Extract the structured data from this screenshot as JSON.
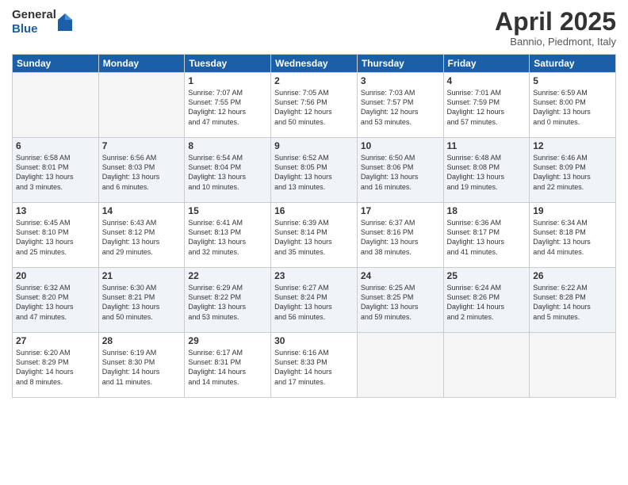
{
  "logo": {
    "general": "General",
    "blue": "Blue"
  },
  "header": {
    "month": "April 2025",
    "location": "Bannio, Piedmont, Italy"
  },
  "weekdays": [
    "Sunday",
    "Monday",
    "Tuesday",
    "Wednesday",
    "Thursday",
    "Friday",
    "Saturday"
  ],
  "weeks": [
    [
      {
        "day": "",
        "info": ""
      },
      {
        "day": "",
        "info": ""
      },
      {
        "day": "1",
        "info": "Sunrise: 7:07 AM\nSunset: 7:55 PM\nDaylight: 12 hours\nand 47 minutes."
      },
      {
        "day": "2",
        "info": "Sunrise: 7:05 AM\nSunset: 7:56 PM\nDaylight: 12 hours\nand 50 minutes."
      },
      {
        "day": "3",
        "info": "Sunrise: 7:03 AM\nSunset: 7:57 PM\nDaylight: 12 hours\nand 53 minutes."
      },
      {
        "day": "4",
        "info": "Sunrise: 7:01 AM\nSunset: 7:59 PM\nDaylight: 12 hours\nand 57 minutes."
      },
      {
        "day": "5",
        "info": "Sunrise: 6:59 AM\nSunset: 8:00 PM\nDaylight: 13 hours\nand 0 minutes."
      }
    ],
    [
      {
        "day": "6",
        "info": "Sunrise: 6:58 AM\nSunset: 8:01 PM\nDaylight: 13 hours\nand 3 minutes."
      },
      {
        "day": "7",
        "info": "Sunrise: 6:56 AM\nSunset: 8:03 PM\nDaylight: 13 hours\nand 6 minutes."
      },
      {
        "day": "8",
        "info": "Sunrise: 6:54 AM\nSunset: 8:04 PM\nDaylight: 13 hours\nand 10 minutes."
      },
      {
        "day": "9",
        "info": "Sunrise: 6:52 AM\nSunset: 8:05 PM\nDaylight: 13 hours\nand 13 minutes."
      },
      {
        "day": "10",
        "info": "Sunrise: 6:50 AM\nSunset: 8:06 PM\nDaylight: 13 hours\nand 16 minutes."
      },
      {
        "day": "11",
        "info": "Sunrise: 6:48 AM\nSunset: 8:08 PM\nDaylight: 13 hours\nand 19 minutes."
      },
      {
        "day": "12",
        "info": "Sunrise: 6:46 AM\nSunset: 8:09 PM\nDaylight: 13 hours\nand 22 minutes."
      }
    ],
    [
      {
        "day": "13",
        "info": "Sunrise: 6:45 AM\nSunset: 8:10 PM\nDaylight: 13 hours\nand 25 minutes."
      },
      {
        "day": "14",
        "info": "Sunrise: 6:43 AM\nSunset: 8:12 PM\nDaylight: 13 hours\nand 29 minutes."
      },
      {
        "day": "15",
        "info": "Sunrise: 6:41 AM\nSunset: 8:13 PM\nDaylight: 13 hours\nand 32 minutes."
      },
      {
        "day": "16",
        "info": "Sunrise: 6:39 AM\nSunset: 8:14 PM\nDaylight: 13 hours\nand 35 minutes."
      },
      {
        "day": "17",
        "info": "Sunrise: 6:37 AM\nSunset: 8:16 PM\nDaylight: 13 hours\nand 38 minutes."
      },
      {
        "day": "18",
        "info": "Sunrise: 6:36 AM\nSunset: 8:17 PM\nDaylight: 13 hours\nand 41 minutes."
      },
      {
        "day": "19",
        "info": "Sunrise: 6:34 AM\nSunset: 8:18 PM\nDaylight: 13 hours\nand 44 minutes."
      }
    ],
    [
      {
        "day": "20",
        "info": "Sunrise: 6:32 AM\nSunset: 8:20 PM\nDaylight: 13 hours\nand 47 minutes."
      },
      {
        "day": "21",
        "info": "Sunrise: 6:30 AM\nSunset: 8:21 PM\nDaylight: 13 hours\nand 50 minutes."
      },
      {
        "day": "22",
        "info": "Sunrise: 6:29 AM\nSunset: 8:22 PM\nDaylight: 13 hours\nand 53 minutes."
      },
      {
        "day": "23",
        "info": "Sunrise: 6:27 AM\nSunset: 8:24 PM\nDaylight: 13 hours\nand 56 minutes."
      },
      {
        "day": "24",
        "info": "Sunrise: 6:25 AM\nSunset: 8:25 PM\nDaylight: 13 hours\nand 59 minutes."
      },
      {
        "day": "25",
        "info": "Sunrise: 6:24 AM\nSunset: 8:26 PM\nDaylight: 14 hours\nand 2 minutes."
      },
      {
        "day": "26",
        "info": "Sunrise: 6:22 AM\nSunset: 8:28 PM\nDaylight: 14 hours\nand 5 minutes."
      }
    ],
    [
      {
        "day": "27",
        "info": "Sunrise: 6:20 AM\nSunset: 8:29 PM\nDaylight: 14 hours\nand 8 minutes."
      },
      {
        "day": "28",
        "info": "Sunrise: 6:19 AM\nSunset: 8:30 PM\nDaylight: 14 hours\nand 11 minutes."
      },
      {
        "day": "29",
        "info": "Sunrise: 6:17 AM\nSunset: 8:31 PM\nDaylight: 14 hours\nand 14 minutes."
      },
      {
        "day": "30",
        "info": "Sunrise: 6:16 AM\nSunset: 8:33 PM\nDaylight: 14 hours\nand 17 minutes."
      },
      {
        "day": "",
        "info": ""
      },
      {
        "day": "",
        "info": ""
      },
      {
        "day": "",
        "info": ""
      }
    ]
  ]
}
